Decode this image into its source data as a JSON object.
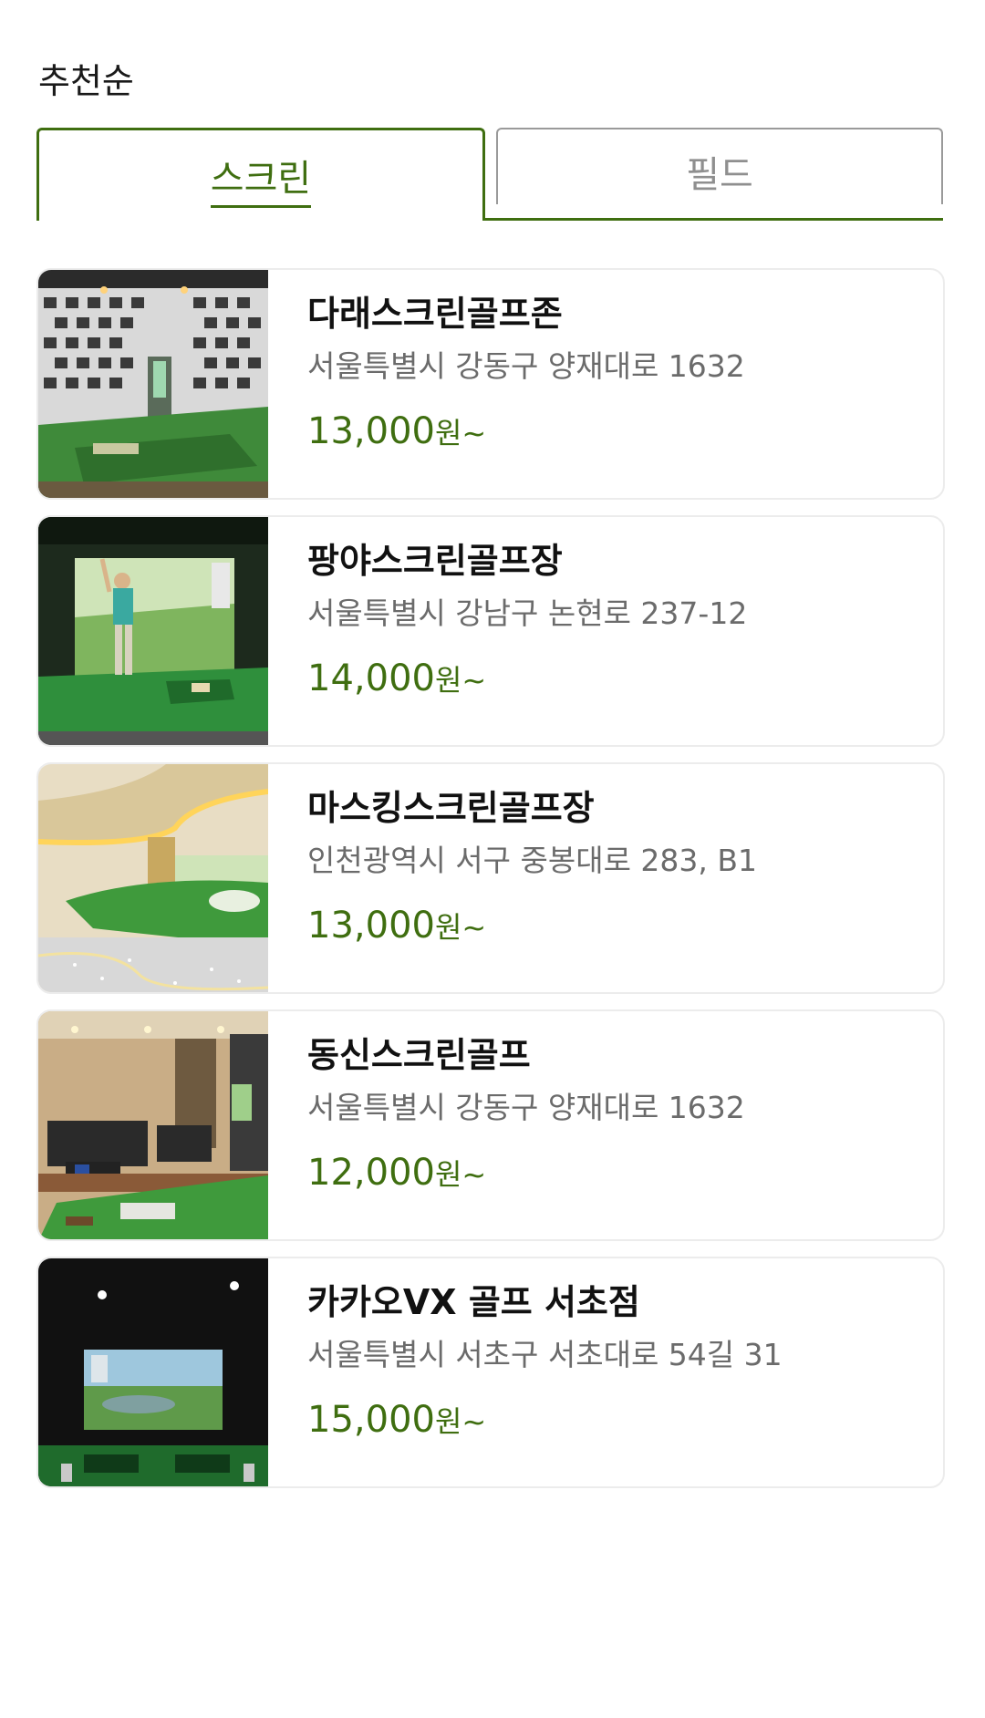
{
  "sort": {
    "label": "추천순"
  },
  "tabs": [
    {
      "label": "스크린",
      "active": true
    },
    {
      "label": "필드",
      "active": false
    }
  ],
  "colors": {
    "accent": "#3f6e10",
    "muted": "#8f8f8f"
  },
  "price_unit": "원~",
  "venues": [
    {
      "name": "다래스크린골프존",
      "address": "서울특별시 강동구 양재대로 1632",
      "price": "13,000"
    },
    {
      "name": "팡야스크린골프장",
      "address": "서울특별시 강남구 논현로 237-12",
      "price": "14,000"
    },
    {
      "name": "마스킹스크린골프장",
      "address": "인천광역시 서구 중봉대로 283, B1",
      "price": "13,000"
    },
    {
      "name": "동신스크린골프",
      "address": "서울특별시 강동구 양재대로 1632",
      "price": "12,000"
    },
    {
      "name": "카카오VX 골프 서초점",
      "address": "서울특별시 서초구 서초대로 54길 31",
      "price": "15,000"
    }
  ]
}
